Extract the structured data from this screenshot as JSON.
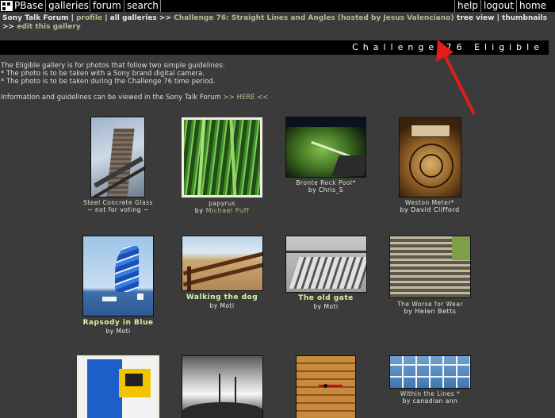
{
  "nav": {
    "logo_text": "PBase",
    "galleries": "galleries",
    "forum": "forum",
    "search": "search",
    "help": "help",
    "logout": "logout",
    "home": "home"
  },
  "breadcrumb": {
    "owner": "Sony Talk Forum",
    "sep1": "|",
    "profile": "profile",
    "sep2": "|",
    "all_galleries": "all galleries",
    "arrow1": ">>",
    "gallery": "Challenge 76: Straight Lines and Angles (hosted by Jesus Valenciano)",
    "arrow2": ">>",
    "edit": "edit this gallery"
  },
  "views": {
    "tree": "tree view",
    "sep": "|",
    "thumbnails": "thumbnails"
  },
  "title_band": "Challenge 76 Eligible",
  "description": {
    "line1": "The Eligible gallery is for photos that follow two simple guidelines:",
    "line2": "* The photo is to be taken with a Sony brand digital camera.",
    "line3": "* The photo is to be taken during the Challenge 76 time period.",
    "line4": "Information and guidelines can be viewed in the Sony Talk Forum",
    "line4_link": ">> HERE <<"
  },
  "photos": [
    {
      "title": "Steel Concrete Glass",
      "by": "~ not for voting ~"
    },
    {
      "title": "papyrus",
      "by_prefix": "by",
      "by_name": "Michael Puff"
    },
    {
      "title": "Bronte Rock Pool*",
      "by": "by Chris_S"
    },
    {
      "title": "Weston Meter*",
      "by": "by David Clifford"
    },
    {
      "title": "Rapsody in Blue",
      "by": "by Moti"
    },
    {
      "title": "Walking the dog",
      "by": "by Moti"
    },
    {
      "title": "The old gate",
      "by": "by Moti"
    },
    {
      "title": "The Worse for Wear",
      "by": "by Helen Betts"
    },
    {
      "title": "Within the Lines *",
      "by": "by canadian ann"
    }
  ]
}
